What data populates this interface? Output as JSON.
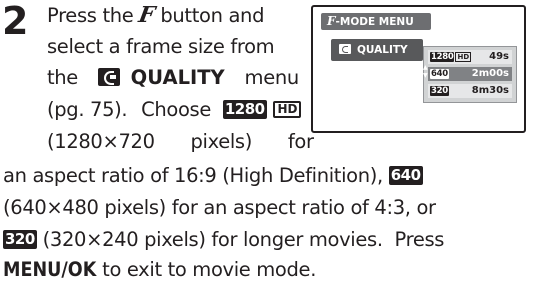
{
  "step": {
    "number": "2"
  },
  "text": {
    "w_press": "Press",
    "w_the": "the",
    "f_glyph": "F",
    "w_button_and": "button and",
    "line2": "select a frame size from",
    "w_the2": "the",
    "quality_label": "QUALITY",
    "w_menu": "menu",
    "line4_a": "(pg. 75).",
    "line4_b": "Choose",
    "badge_1280": "1280",
    "badge_hd": "HD",
    "line5_a": "(1280×720",
    "line5_b": "pixels)",
    "line5_c": "for",
    "line6": "an aspect ratio of 16:9 (High Definition),",
    "badge_640": "640",
    "line7_a": "(640×480 pixels) for an aspect ratio of 4:3, or",
    "badge_320": "320",
    "line8_a": "(320×240 pixels) for longer movies.",
    "line8_b": "Press",
    "menu_ok": "MENU/OK",
    "line9_b": "to exit to movie mode."
  },
  "screen": {
    "title_f": "F",
    "title": "-MODE MENU",
    "quality": "QUALITY",
    "options": [
      {
        "res": "1280",
        "hd": "HD",
        "time": "49s"
      },
      {
        "res": "640",
        "time": "2m00s"
      },
      {
        "res": "320",
        "time": "8m30s"
      }
    ],
    "selected": "640"
  },
  "colors": {
    "text": "#231f20",
    "title_bar": "#6d6e71",
    "highlight": "#808285"
  }
}
